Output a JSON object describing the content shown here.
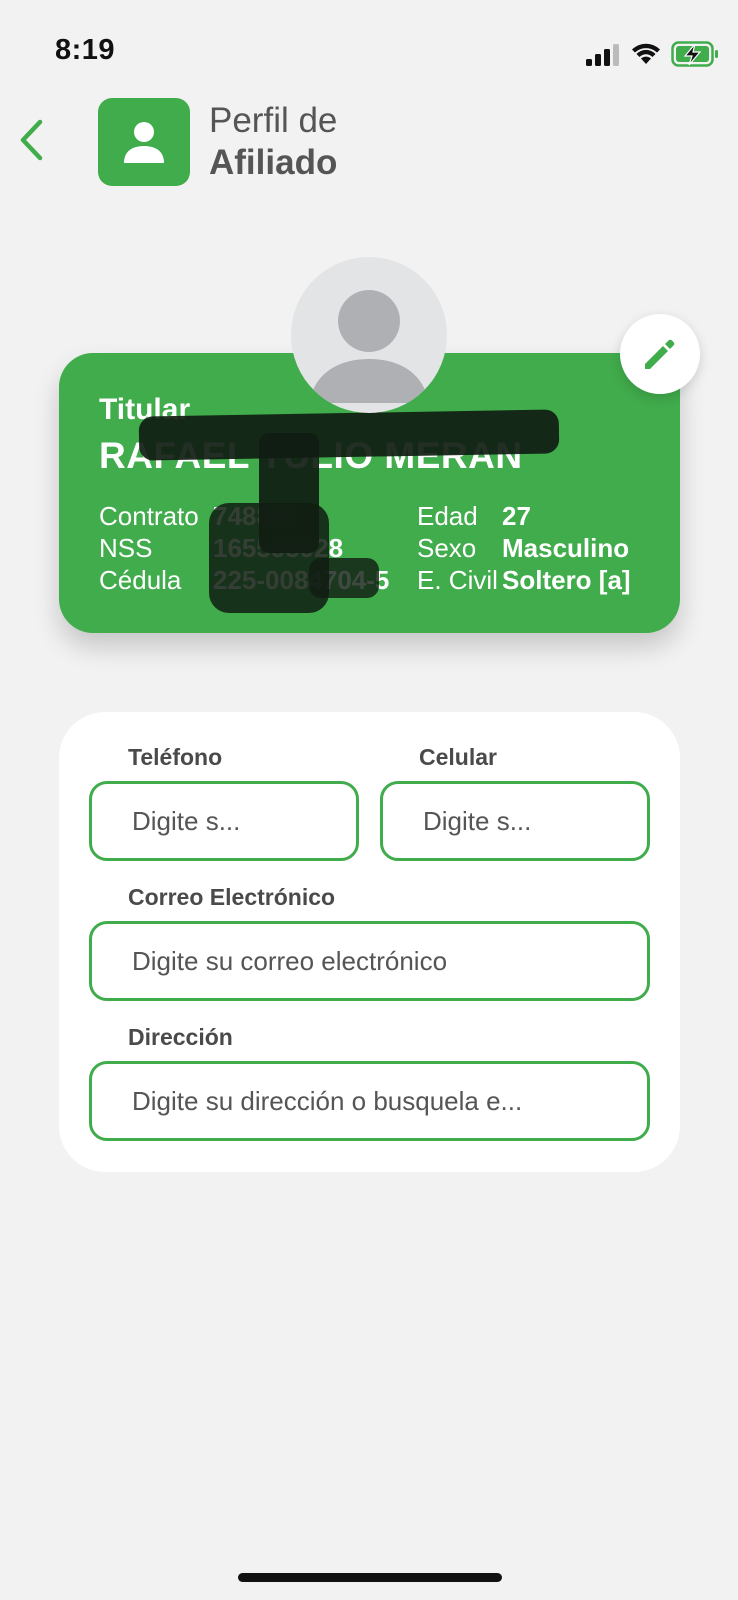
{
  "status_bar": {
    "time": "8:19",
    "icons": [
      "signal-icon",
      "wifi-icon",
      "battery-charging-icon"
    ]
  },
  "header": {
    "title_line1": "Perfil de",
    "title_line2": "Afiliado",
    "back_icon": "chevron-left-icon",
    "profile_icon": "user-icon"
  },
  "profile_card": {
    "titular_label": "Titular",
    "name": "RAFAEL TULIO MERAN",
    "fields_left": [
      {
        "label": "Contrato",
        "value": "748894"
      },
      {
        "label": "NSS",
        "value": "165595928"
      },
      {
        "label": "Cédula",
        "value": "225-0084704-5"
      }
    ],
    "fields_right": [
      {
        "label": "Edad",
        "value": "27"
      },
      {
        "label": "Sexo",
        "value": "Masculino"
      },
      {
        "label": "E. Civil",
        "value": "Soltero [a]"
      }
    ],
    "edit_icon": "pencil-icon"
  },
  "form": {
    "telefono": {
      "label": "Teléfono",
      "placeholder": "Digite s..."
    },
    "celular": {
      "label": "Celular",
      "placeholder": "Digite s..."
    },
    "correo": {
      "label": "Correo Electrónico",
      "placeholder": "Digite su correo electrónico"
    },
    "direccion": {
      "label": "Dirección",
      "placeholder": "Digite su dirección o busquela e..."
    }
  },
  "colors": {
    "accent": "#41ac4c",
    "background": "#f2f2f2"
  }
}
